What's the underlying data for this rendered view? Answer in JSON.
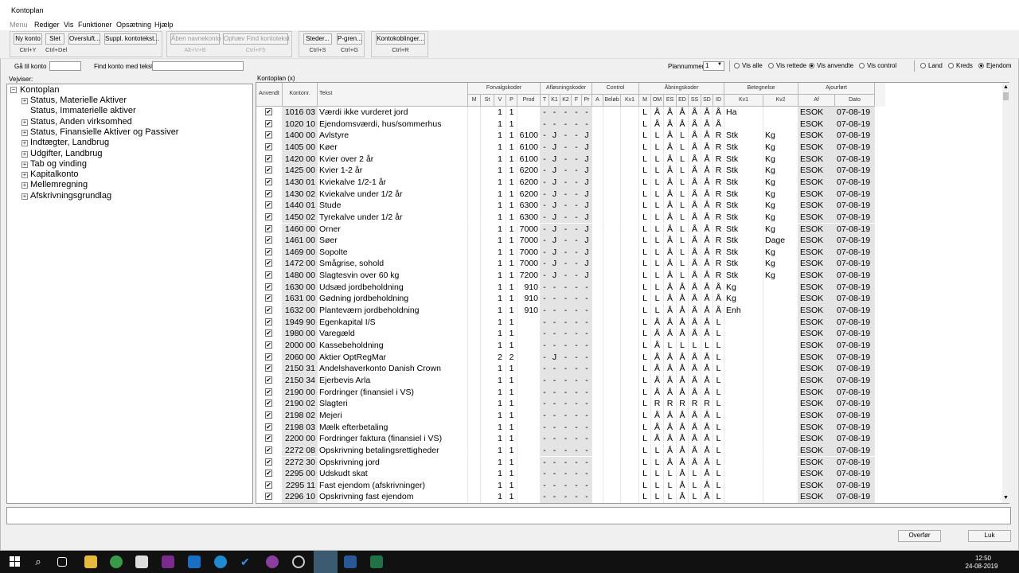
{
  "window": {
    "title": "Kontoplan"
  },
  "menu": [
    "Menu",
    "Rediger",
    "Vis",
    "Funktioner",
    "Opsætning",
    "Hjælp"
  ],
  "toolbar": {
    "g1": [
      {
        "label": "Ny konto",
        "sc": "Ctrl+Y"
      },
      {
        "label": "Slet",
        "sc": "Ctrl+Del"
      },
      {
        "label": "Oversluft...",
        "sc": ""
      },
      {
        "label": "Suppl. kontotekst...",
        "sc": ""
      }
    ],
    "g2": [
      {
        "label": "Åben navnekonto",
        "sc": "Alt+V+B"
      },
      {
        "label": "Ophæv Find kontotekst",
        "sc": "Ctrl+F5"
      }
    ],
    "g3": [
      {
        "label": "Steder...",
        "sc": "Ctrl+S"
      },
      {
        "label": "P-gren...",
        "sc": "Ctrl+G"
      }
    ],
    "g4": [
      {
        "label": "Kontokoblinger...",
        "sc": "Ctrl+R"
      }
    ]
  },
  "search": {
    "goto_label": "Gå til konto",
    "find_label": "Find konto med tekst",
    "plan_label": "Plannummer",
    "plan_value": "1",
    "radios1": [
      {
        "label": "Vis alle",
        "on": false
      },
      {
        "label": "Vis rettede",
        "on": false
      },
      {
        "label": "Vis anvendte",
        "on": true
      },
      {
        "label": "Vis control",
        "on": false
      }
    ],
    "radios2": [
      {
        "label": "Land",
        "on": false
      },
      {
        "label": "Kreds",
        "on": false
      },
      {
        "label": "Ejendom",
        "on": true
      }
    ]
  },
  "left": {
    "caption": "Vejviser:",
    "root": "Kontoplan",
    "items": [
      "Status, Materielle Aktiver",
      "Status, Immaterielle aktiver",
      "Status, Anden virksomhed",
      "Status, Finansielle Aktiver og Passiver",
      "Indtægter, Landbrug",
      "Udgifter, Landbrug",
      "Tab og vinding",
      "Kapitalkonto",
      "Mellemregning",
      "Afskrivningsgrundlag"
    ]
  },
  "grid": {
    "caption": "Kontoplan (x)",
    "groups": [
      "Forvalgskoder",
      "Afløsningskoder",
      "Control",
      "Åbningskoder",
      "Betegnelse",
      "Ajourført"
    ],
    "cols": [
      "Anvendt",
      "Kontonr.",
      "Tekst",
      "M",
      "St",
      "V",
      "P",
      "Prod",
      "T",
      "K1",
      "K2",
      "F",
      "Pr",
      "A",
      "Beløb",
      "Kv1",
      "M",
      "OM",
      "ES",
      "ED",
      "SS",
      "SD",
      "ID",
      "Kv1",
      "Kv2",
      "Af",
      "Dato"
    ],
    "rows": [
      [
        "1016 03",
        "Værdi ikke vurderet jord",
        "1",
        "1",
        "",
        "-",
        "-",
        "-",
        "-",
        "-",
        "",
        "L",
        "Å",
        "Å",
        "Å",
        "Å",
        "Å",
        "Å",
        "Ha",
        "",
        "ESOK",
        "07-08-19"
      ],
      [
        "1020 10",
        "Ejendomsværdi, hus/sommerhus",
        "1",
        "1",
        "",
        "-",
        "-",
        "-",
        "-",
        "-",
        "",
        "L",
        "Å",
        "Å",
        "Å",
        "Å",
        "Å",
        "Å",
        "",
        "",
        "ESOK",
        "07-08-19"
      ],
      [
        "1400 00",
        "Avlstyre",
        "1",
        "1",
        "6100",
        "-",
        "J",
        "-",
        "-",
        "J",
        "",
        "L",
        "L",
        "Å",
        "L",
        "Å",
        "Å",
        "R",
        "Stk",
        "Kg",
        "ESOK",
        "07-08-19"
      ],
      [
        "1405 00",
        "Køer",
        "1",
        "1",
        "6100",
        "-",
        "J",
        "-",
        "-",
        "J",
        "",
        "L",
        "L",
        "Å",
        "L",
        "Å",
        "Å",
        "R",
        "Stk",
        "Kg",
        "ESOK",
        "07-08-19"
      ],
      [
        "1420 00",
        "Kvier over 2 år",
        "1",
        "1",
        "6100",
        "-",
        "J",
        "-",
        "-",
        "J",
        "",
        "L",
        "L",
        "Å",
        "L",
        "Å",
        "Å",
        "R",
        "Stk",
        "Kg",
        "ESOK",
        "07-08-19"
      ],
      [
        "1425 00",
        "Kvier 1-2 år",
        "1",
        "1",
        "6200",
        "-",
        "J",
        "-",
        "-",
        "J",
        "",
        "L",
        "L",
        "Å",
        "L",
        "Å",
        "Å",
        "R",
        "Stk",
        "Kg",
        "ESOK",
        "07-08-19"
      ],
      [
        "1430 01",
        "Kviekalve 1/2-1 år",
        "1",
        "1",
        "6200",
        "-",
        "J",
        "-",
        "-",
        "J",
        "",
        "L",
        "L",
        "Å",
        "L",
        "Å",
        "Å",
        "R",
        "Stk",
        "Kg",
        "ESOK",
        "07-08-19"
      ],
      [
        "1430 02",
        "Kviekalve under 1/2 år",
        "1",
        "1",
        "6200",
        "-",
        "J",
        "-",
        "-",
        "J",
        "",
        "L",
        "L",
        "Å",
        "L",
        "Å",
        "Å",
        "R",
        "Stk",
        "Kg",
        "ESOK",
        "07-08-19"
      ],
      [
        "1440 01",
        "Stude",
        "1",
        "1",
        "6300",
        "-",
        "J",
        "-",
        "-",
        "J",
        "",
        "L",
        "L",
        "Å",
        "L",
        "Å",
        "Å",
        "R",
        "Stk",
        "Kg",
        "ESOK",
        "07-08-19"
      ],
      [
        "1450 02",
        "Tyrekalve under 1/2 år",
        "1",
        "1",
        "6300",
        "-",
        "J",
        "-",
        "-",
        "J",
        "",
        "L",
        "L",
        "Å",
        "L",
        "Å",
        "Å",
        "R",
        "Stk",
        "Kg",
        "ESOK",
        "07-08-19"
      ],
      [
        "1460 00",
        "Orner",
        "1",
        "1",
        "7000",
        "-",
        "J",
        "-",
        "-",
        "J",
        "",
        "L",
        "L",
        "Å",
        "L",
        "Å",
        "Å",
        "R",
        "Stk",
        "Kg",
        "ESOK",
        "07-08-19"
      ],
      [
        "1461 00",
        "Søer",
        "1",
        "1",
        "7000",
        "-",
        "J",
        "-",
        "-",
        "J",
        "",
        "L",
        "L",
        "Å",
        "L",
        "Å",
        "Å",
        "R",
        "Stk",
        "Dage",
        "ESOK",
        "07-08-19"
      ],
      [
        "1469 00",
        "Sopolte",
        "1",
        "1",
        "7000",
        "-",
        "J",
        "-",
        "-",
        "J",
        "",
        "L",
        "L",
        "Å",
        "L",
        "Å",
        "Å",
        "R",
        "Stk",
        "Kg",
        "ESOK",
        "07-08-19"
      ],
      [
        "1472 00",
        "Smågrise, sohold",
        "1",
        "1",
        "7000",
        "-",
        "J",
        "-",
        "-",
        "J",
        "",
        "L",
        "L",
        "Å",
        "L",
        "Å",
        "Å",
        "R",
        "Stk",
        "Kg",
        "ESOK",
        "07-08-19"
      ],
      [
        "1480 00",
        "Slagtesvin over 60 kg",
        "1",
        "1",
        "7200",
        "-",
        "J",
        "-",
        "-",
        "J",
        "",
        "L",
        "L",
        "Å",
        "L",
        "Å",
        "Å",
        "R",
        "Stk",
        "Kg",
        "ESOK",
        "07-08-19"
      ],
      [
        "1630 00",
        "Udsæd jordbeholdning",
        "1",
        "1",
        "910",
        "-",
        "-",
        "-",
        "-",
        "-",
        "",
        "L",
        "L",
        "Å",
        "Å",
        "Å",
        "Å",
        "Å",
        "Kg",
        "",
        "ESOK",
        "07-08-19"
      ],
      [
        "1631 00",
        "Gødning jordbeholdning",
        "1",
        "1",
        "910",
        "-",
        "-",
        "-",
        "-",
        "-",
        "",
        "L",
        "L",
        "Å",
        "Å",
        "Å",
        "Å",
        "Å",
        "Kg",
        "",
        "ESOK",
        "07-08-19"
      ],
      [
        "1632 00",
        "Planteværn jordbeholdning",
        "1",
        "1",
        "910",
        "-",
        "-",
        "-",
        "-",
        "-",
        "",
        "L",
        "L",
        "Å",
        "Å",
        "Å",
        "Å",
        "Å",
        "Enh",
        "",
        "ESOK",
        "07-08-19"
      ],
      [
        "1949 90",
        "Egenkapital I/S",
        "1",
        "1",
        "",
        "-",
        "-",
        "-",
        "-",
        "-",
        "",
        "L",
        "Å",
        "Å",
        "Å",
        "Å",
        "Å",
        "L",
        "",
        "",
        "ESOK",
        "07-08-19"
      ],
      [
        "1980 00",
        "Varegæld",
        "1",
        "1",
        "",
        "-",
        "-",
        "-",
        "-",
        "-",
        "",
        "L",
        "Å",
        "Å",
        "Å",
        "Å",
        "Å",
        "L",
        "",
        "",
        "ESOK",
        "07-08-19"
      ],
      [
        "2000 00",
        "Kassebeholdning",
        "1",
        "1",
        "",
        "-",
        "-",
        "-",
        "-",
        "-",
        "",
        "L",
        "Å",
        "L",
        "L",
        "L",
        "L",
        "L",
        "",
        "",
        "ESOK",
        "07-08-19"
      ],
      [
        "2060 00",
        "Aktier OptRegMar",
        "2",
        "2",
        "",
        "-",
        "J",
        "-",
        "-",
        "-",
        "",
        "L",
        "Å",
        "Å",
        "Å",
        "Å",
        "Å",
        "L",
        "",
        "",
        "ESOK",
        "07-08-19"
      ],
      [
        "2150 31",
        "Andelshaverkonto Danish Crown",
        "1",
        "1",
        "",
        "-",
        "-",
        "-",
        "-",
        "-",
        "",
        "L",
        "Å",
        "Å",
        "Å",
        "Å",
        "Å",
        "L",
        "",
        "",
        "ESOK",
        "07-08-19"
      ],
      [
        "2150 34",
        "Ejerbevis Arla",
        "1",
        "1",
        "",
        "-",
        "-",
        "-",
        "-",
        "-",
        "",
        "L",
        "Å",
        "Å",
        "Å",
        "Å",
        "Å",
        "L",
        "",
        "",
        "ESOK",
        "07-08-19"
      ],
      [
        "2190 00",
        "Fordringer (finansiel i VS)",
        "1",
        "1",
        "",
        "-",
        "-",
        "-",
        "-",
        "-",
        "",
        "L",
        "Å",
        "Å",
        "Å",
        "Å",
        "Å",
        "L",
        "",
        "",
        "ESOK",
        "07-08-19"
      ],
      [
        "2190 02",
        "Slagteri",
        "1",
        "1",
        "",
        "-",
        "-",
        "-",
        "-",
        "-",
        "",
        "L",
        "R",
        "R",
        "R",
        "R",
        "R",
        "L",
        "",
        "",
        "ESOK",
        "07-08-19"
      ],
      [
        "2198 02",
        "Mejeri",
        "1",
        "1",
        "",
        "-",
        "-",
        "-",
        "-",
        "-",
        "",
        "L",
        "Å",
        "Å",
        "Å",
        "Å",
        "Å",
        "L",
        "",
        "",
        "ESOK",
        "07-08-19"
      ],
      [
        "2198 03",
        "Mælk efterbetaling",
        "1",
        "1",
        "",
        "-",
        "-",
        "-",
        "-",
        "-",
        "",
        "L",
        "Å",
        "Å",
        "Å",
        "Å",
        "Å",
        "L",
        "",
        "",
        "ESOK",
        "07-08-19"
      ],
      [
        "2200 00",
        "Fordringer faktura (finansiel i VS)",
        "1",
        "1",
        "",
        "-",
        "-",
        "-",
        "-",
        "-",
        "",
        "L",
        "Å",
        "Å",
        "Å",
        "Å",
        "Å",
        "L",
        "",
        "",
        "ESOK",
        "07-08-19"
      ],
      [
        "2272 08",
        "Opskrivning betalingsrettigheder",
        "1",
        "1",
        "",
        "-",
        "-",
        "-",
        "-",
        "-",
        "",
        "L",
        "L",
        "Å",
        "Å",
        "Å",
        "Å",
        "L",
        "",
        "",
        "ESOK",
        "07-08-19"
      ],
      [
        "2272 30",
        "Opskrivning jord",
        "1",
        "1",
        "",
        "-",
        "-",
        "-",
        "-",
        "-",
        "",
        "L",
        "L",
        "Å",
        "Å",
        "Å",
        "Å",
        "L",
        "",
        "",
        "ESOK",
        "07-08-19"
      ],
      [
        "2295 00",
        "Udskudt skat",
        "1",
        "1",
        "",
        "-",
        "-",
        "-",
        "-",
        "-",
        "",
        "L",
        "L",
        "L",
        "Å",
        "L",
        "Å",
        "L",
        "",
        "",
        "ESOK",
        "07-08-19"
      ],
      [
        "2295 11",
        "Fast ejendom (afskrivninger)",
        "1",
        "1",
        "",
        "-",
        "-",
        "-",
        "-",
        "-",
        "",
        "L",
        "L",
        "L",
        "Å",
        "L",
        "Å",
        "L",
        "",
        "",
        "ESOK",
        "07-08-19"
      ],
      [
        "2296 10",
        "Opskrivning fast ejendom",
        "1",
        "1",
        "",
        "-",
        "-",
        "-",
        "-",
        "-",
        "",
        "L",
        "L",
        "L",
        "Å",
        "L",
        "Å",
        "L",
        "",
        "",
        "ESOK",
        "07-08-19"
      ]
    ]
  },
  "footer": {
    "ok": "Overfør",
    "close": "Luk"
  },
  "taskbar": {
    "time": "12:50",
    "date": "24-08-2019"
  }
}
